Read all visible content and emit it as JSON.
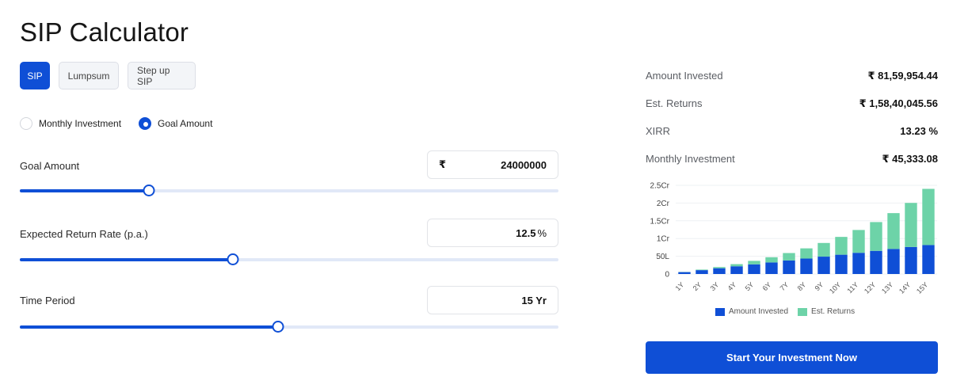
{
  "page": {
    "title": "SIP Calculator"
  },
  "tabs": [
    {
      "label": "SIP",
      "active": true
    },
    {
      "label": "Lumpsum",
      "active": false
    },
    {
      "label": "Step up SIP",
      "active": false
    }
  ],
  "mode": {
    "options": [
      "Monthly Investment",
      "Goal Amount"
    ],
    "selected": "Goal Amount"
  },
  "inputs": {
    "goal_amount": {
      "label": "Goal Amount",
      "prefix": "₹",
      "value": "24000000",
      "slider_fraction": 0.24
    },
    "return_rate": {
      "label": "Expected Return Rate (p.a.)",
      "value": "12.5",
      "suffix": "%",
      "slider_fraction": 0.395
    },
    "time_period": {
      "label": "Time Period",
      "value": "15 Yr",
      "slider_fraction": 0.48
    }
  },
  "summary": {
    "amount_invested": {
      "label": "Amount Invested",
      "value": "₹ 81,59,954.44"
    },
    "est_returns": {
      "label": "Est. Returns",
      "value": "₹ 1,58,40,045.56"
    },
    "xirr": {
      "label": "XIRR",
      "value": "13.23 %"
    },
    "monthly_investment": {
      "label": "Monthly Investment",
      "value": "₹ 45,333.08"
    }
  },
  "colors": {
    "accent": "#0f4fd6",
    "invested": "#0f4fd6",
    "returns": "#6dd3a8"
  },
  "chart_data": {
    "type": "bar",
    "stacked": true,
    "categories": [
      "1Y",
      "2Y",
      "3Y",
      "4Y",
      "5Y",
      "6Y",
      "7Y",
      "8Y",
      "9Y",
      "10Y",
      "11Y",
      "12Y",
      "13Y",
      "14Y",
      "15Y"
    ],
    "y_tick_labels": [
      "0",
      "50L",
      "1Cr",
      "1.5Cr",
      "2Cr",
      "2.5Cr"
    ],
    "y_ticks_lakh": [
      0,
      50,
      100,
      150,
      200,
      250
    ],
    "ylim_lakh": [
      0,
      250
    ],
    "series": [
      {
        "name": "Amount Invested",
        "color": "#0f4fd6",
        "values_lakh": [
          5.4,
          10.9,
          16.3,
          21.8,
          27.2,
          32.6,
          38.1,
          43.5,
          49.0,
          54.4,
          59.8,
          65.3,
          70.7,
          76.2,
          81.6
        ]
      },
      {
        "name": "Est. Returns",
        "color": "#6dd3a8",
        "values_lakh": [
          0.4,
          1.5,
          3.3,
          6.0,
          9.8,
          14.7,
          21.0,
          28.8,
          38.5,
          50.2,
          64.3,
          81.1,
          100.9,
          124.2,
          158.4
        ]
      }
    ],
    "legend_position": "bottom",
    "grid": true
  },
  "cta": {
    "label": "Start Your Investment Now"
  }
}
